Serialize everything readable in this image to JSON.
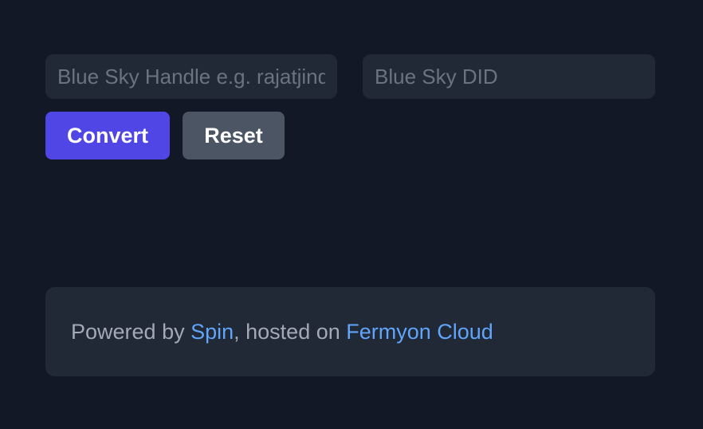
{
  "form": {
    "handle_placeholder": "Blue Sky Handle e.g. rajatjindal.com",
    "handle_value": "",
    "did_placeholder": "Blue Sky DID",
    "did_value": "",
    "convert_label": "Convert",
    "reset_label": "Reset"
  },
  "footer": {
    "prefix": "Powered by ",
    "spin_link": "Spin",
    "middle": ", hosted on ",
    "fermyon_link": "Fermyon Cloud"
  },
  "colors": {
    "background": "#121826",
    "panel": "#212836",
    "primary_button": "#4f46e5",
    "secondary_button": "#4b5563",
    "link": "#60a5fa"
  }
}
